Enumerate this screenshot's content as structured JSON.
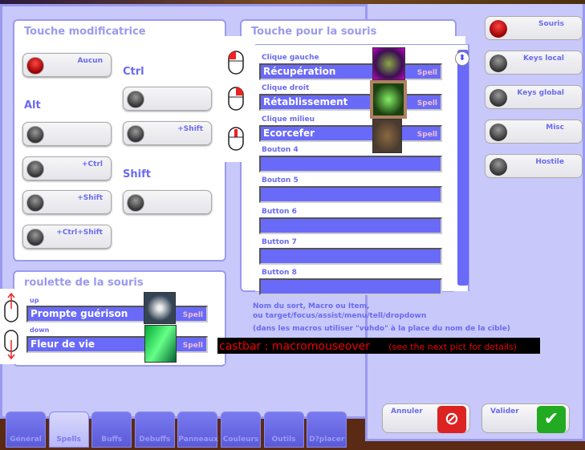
{
  "modifier_panel": {
    "title": "Touche modificatrice",
    "sections": {
      "ctrl": "Ctrl",
      "alt": "Alt",
      "shift": "Shift"
    },
    "toggles": [
      {
        "label": "Aucun",
        "on": true
      },
      {
        "label": "",
        "on": false
      },
      {
        "label": "+Ctrl",
        "on": false
      },
      {
        "label": "+Shift",
        "on": false
      },
      {
        "label": "+Ctrl+Shift",
        "on": false
      },
      {
        "label": "",
        "on": false
      },
      {
        "label": "+Shift",
        "on": false
      },
      {
        "label": "",
        "on": false
      }
    ]
  },
  "mouse_panel": {
    "title": "Touche pour la souris",
    "rows": [
      {
        "label": "Clique gauche",
        "value": "Récupération",
        "type": "Spell"
      },
      {
        "label": "Clique droit",
        "value": "Rétablissement",
        "type": "Spell"
      },
      {
        "label": "Clique milieu",
        "value": "Ecorcefer",
        "type": "Spell"
      },
      {
        "label": "Bouton 4",
        "value": "",
        "type": ""
      },
      {
        "label": "Bouton 5",
        "value": "",
        "type": ""
      },
      {
        "label": "Button 6",
        "value": "",
        "type": ""
      },
      {
        "label": "Button 7",
        "value": "",
        "type": ""
      },
      {
        "label": "Button 8",
        "value": "",
        "type": ""
      }
    ]
  },
  "hint": {
    "line1": "Nom du sort, Macro ou Item,",
    "line2": "ou target/focus/assist/menu/tell/dropdown",
    "line3": "(dans les macros utiliser \"vuhdo\" à la place du nom de la cible)"
  },
  "wheel_panel": {
    "title": "roulette de la souris",
    "rows": [
      {
        "label": "up",
        "value": "Prompte guérison",
        "type": "Spell"
      },
      {
        "label": "down",
        "value": "Fleur de vie",
        "type": "Spell"
      }
    ]
  },
  "annotation": {
    "main": "castbar : macromouseover",
    "note": "(see the next pict for details)"
  },
  "right_buttons": [
    {
      "label": "Souris",
      "on": true
    },
    {
      "label": "Keys local",
      "on": false
    },
    {
      "label": "Keys global",
      "on": false
    },
    {
      "label": "Misc",
      "on": false
    },
    {
      "label": "Hostile",
      "on": false
    }
  ],
  "actions": {
    "cancel": "Annuler",
    "ok": "Valider"
  },
  "tabs": [
    {
      "label": "Général"
    },
    {
      "label": "Spells",
      "selected": true
    },
    {
      "label": "Buffs"
    },
    {
      "label": "Debuffs"
    },
    {
      "label": "Panneaux"
    },
    {
      "label": "Couleurs"
    },
    {
      "label": "Outils"
    },
    {
      "label": "D?placer"
    }
  ],
  "colors": {
    "accent": "#6a6af8",
    "frame": "#c8c8fa",
    "active_led": "#cc0000"
  }
}
